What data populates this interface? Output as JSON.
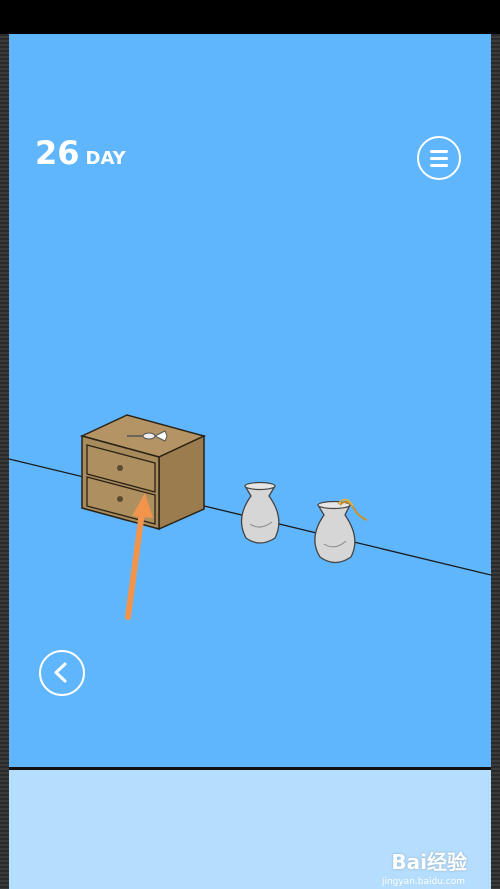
{
  "hud": {
    "day_number": "26",
    "day_label": "DAY"
  },
  "icons": {
    "menu": "hamburger-menu-icon",
    "back": "chevron-left-icon",
    "dart": "dart-icon",
    "hint_arrow": "arrow-up-icon"
  },
  "colors": {
    "background": "#5fb6fd",
    "lower_panel": "#b5ddfd",
    "cabinet": "#a88b5c",
    "vase": "#d3d3d3",
    "hint_arrow": "#f3944d"
  },
  "watermark": {
    "brand": "Bai经验",
    "url": "jingyan.baidu.com"
  }
}
